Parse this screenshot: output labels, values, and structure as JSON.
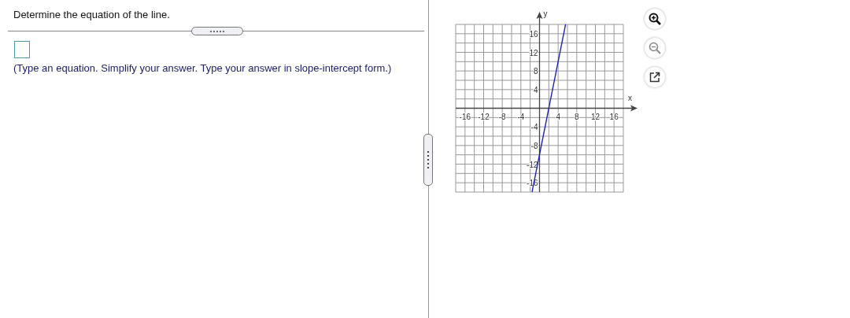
{
  "question": "Determine the equation of the line.",
  "instruction": "(Type an equation. Simplify your answer. Type your answer in slope-intercept form.)",
  "graph": {
    "chart_data": {
      "type": "line",
      "xlabel": "x",
      "ylabel": "y",
      "x": [
        -1.6,
        5.6
      ],
      "series": [
        {
          "color": "#1a1acc",
          "values": [
            -18,
            18
          ]
        }
      ],
      "grid": true,
      "xlim": [
        -18,
        18
      ],
      "ylim": [
        -18,
        18
      ],
      "xticks": [
        -16,
        -12,
        -8,
        -4,
        4,
        8,
        12,
        16
      ],
      "yticks": [
        -16,
        -12,
        -8,
        -4,
        4,
        8,
        12,
        16
      ]
    }
  },
  "tools": [
    {
      "kind": "zoom_in"
    },
    {
      "kind": "zoom_out"
    },
    {
      "kind": "popout"
    }
  ]
}
